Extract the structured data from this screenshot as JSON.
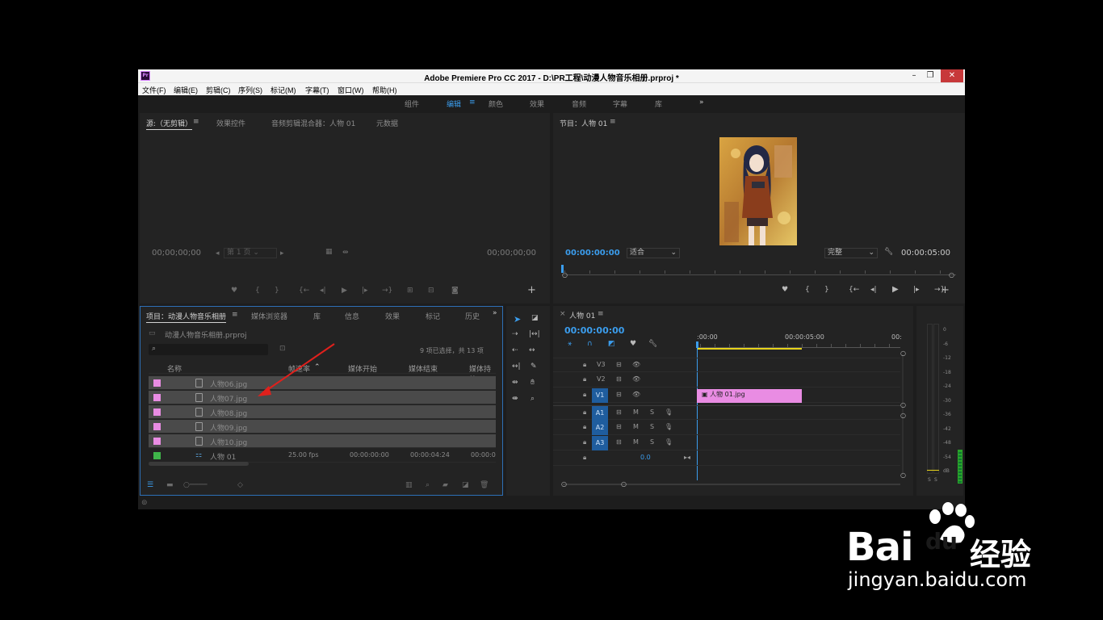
{
  "titlebar": {
    "app_title": "Adobe Premiere Pro CC 2017 - D:\\PR工程\\动漫人物音乐相册.prproj *",
    "logo": "Pr",
    "minimize": "–",
    "restore": "❐",
    "close": "✕"
  },
  "menu": [
    "文件(F)",
    "编辑(E)",
    "剪辑(C)",
    "序列(S)",
    "标记(M)",
    "字幕(T)",
    "窗口(W)",
    "帮助(H)"
  ],
  "workspaces": {
    "items": [
      "组件",
      "编辑",
      "颜色",
      "效果",
      "音频",
      "字幕",
      "库"
    ],
    "active": "编辑",
    "more": "»",
    "menu_icon": "≡"
  },
  "source_panel": {
    "tabs": [
      "源:（无剪辑）",
      "效果控件",
      "音频剪辑混合器：人物 01",
      "元数据"
    ],
    "tab_menu_icon": "≡",
    "timecode_left": "00;00;00;00",
    "timecode_right": "00;00;00;00",
    "page_select": "第 1 页"
  },
  "program_panel": {
    "title": "节目：人物 01",
    "tab_menu_icon": "≡",
    "timecode_current": "00:00:00:00",
    "fit_select": "适合",
    "quality_select": "完整",
    "timecode_duration": "00:00:05:00"
  },
  "project_panel": {
    "tabs": [
      "项目：动漫人物音乐相册",
      "媒体浏览器",
      "库",
      "信息",
      "效果",
      "标记",
      "历史"
    ],
    "tab_menu_icon": "≡",
    "more": "»",
    "project_file": "动漫人物音乐相册.prproj",
    "search_placeholder": "",
    "selection_status": "9 项已选择，共 13 项",
    "columns": [
      "名称",
      "帧速率",
      "媒体开始",
      "媒体结束",
      "媒体持续"
    ],
    "rows": [
      {
        "name": "人物06.jpg",
        "color": "#e98ce3",
        "fps": "",
        "start": "",
        "end": "",
        "selected": true
      },
      {
        "name": "人物07.jpg",
        "color": "#e98ce3",
        "fps": "",
        "start": "",
        "end": "",
        "selected": true
      },
      {
        "name": "人物08.jpg",
        "color": "#e98ce3",
        "fps": "",
        "start": "",
        "end": "",
        "selected": true
      },
      {
        "name": "人物09.jpg",
        "color": "#e98ce3",
        "fps": "",
        "start": "",
        "end": "",
        "selected": true
      },
      {
        "name": "人物10.jpg",
        "color": "#e98ce3",
        "fps": "",
        "start": "",
        "end": "",
        "selected": true
      },
      {
        "name": "人物 01",
        "color": "#3fb54a",
        "fps": "25.00 fps",
        "start": "00:00:00:00",
        "end": "00:00:04:24",
        "selected": false
      }
    ],
    "last_dur_fragment": "00:00:0"
  },
  "timeline": {
    "title": "人物 01",
    "close": "×",
    "tab_menu_icon": "≡",
    "timecode": "00:00:00:00",
    "ruler": [
      ":00:00",
      "00:00:05:00",
      "00:"
    ],
    "video_tracks": [
      {
        "name": "V3",
        "active": false
      },
      {
        "name": "V2",
        "active": false
      },
      {
        "name": "V1",
        "active": true
      }
    ],
    "audio_tracks": [
      {
        "name": "A1"
      },
      {
        "name": "A2"
      },
      {
        "name": "A3"
      }
    ],
    "mute": "M",
    "solo": "S",
    "master_level": "0.0",
    "clip_name": "人物 01.jpg"
  },
  "meter": {
    "labels": [
      "0",
      "-6",
      "-12",
      "-18",
      "-24",
      "-30",
      "-36",
      "-42",
      "-48",
      "-54",
      "dB"
    ],
    "solo_labels": [
      "S",
      "S"
    ]
  },
  "watermark": {
    "brand": "Bai",
    "brand2": "du",
    "suffix": "经验",
    "url": "jingyan.baidu.com"
  }
}
